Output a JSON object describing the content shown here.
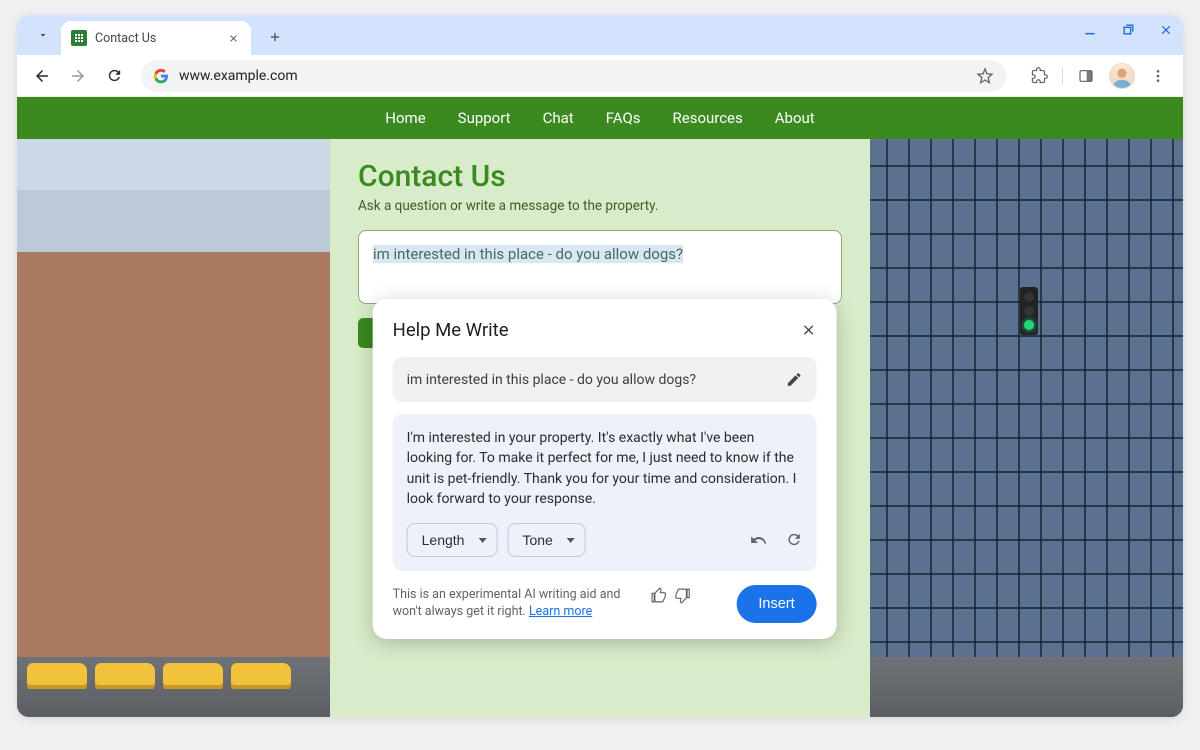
{
  "browser": {
    "tab": {
      "title": "Contact Us"
    },
    "url": "www.example.com"
  },
  "nav": {
    "items": [
      "Home",
      "Support",
      "Chat",
      "FAQs",
      "Resources",
      "About"
    ]
  },
  "page": {
    "heading": "Contact Us",
    "subheading": "Ask a question or write a message to the property.",
    "textarea_value": "im interested in this place - do you allow dogs?"
  },
  "hmw": {
    "title": "Help Me Write",
    "prompt": "im interested in this place - do you allow dogs?",
    "result": "I'm interested in your property. It's exactly what I've been looking for. To make it perfect for me, I just need to know if the unit is pet-friendly. Thank you for your time and consideration. I look forward to your response.",
    "length_label": "Length",
    "tone_label": "Tone",
    "disclaimer_a": "This is an experimental AI writing aid and won't always get it right. ",
    "learn_more": "Learn more",
    "insert_label": "Insert"
  }
}
